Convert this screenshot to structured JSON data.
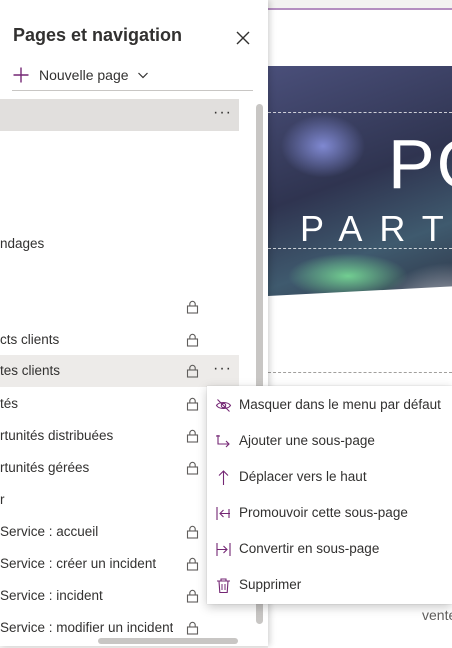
{
  "preview": {
    "hero_title": "PO",
    "hero_subtitle": "PART",
    "footer_text": "vente"
  },
  "panel": {
    "title": "Pages et navigation",
    "new_page_label": "Nouvelle page"
  },
  "nav_items": [
    {
      "label": "",
      "lock": false,
      "selected": true,
      "more": true
    },
    {
      "label": "",
      "lock": false
    },
    {
      "label": "ndages",
      "lock": false
    },
    {
      "label": "",
      "lock": false
    },
    {
      "label": "",
      "lock": true
    },
    {
      "label": "cts clients",
      "lock": true
    },
    {
      "label": "tes clients",
      "lock": true,
      "hover": true,
      "more": true
    },
    {
      "label": "tés",
      "lock": true
    },
    {
      "label": "rtunités distribuées",
      "lock": true
    },
    {
      "label": "rtunités gérées",
      "lock": true
    },
    {
      "label": "r",
      "lock": false
    },
    {
      "label": "Service : accueil",
      "lock": true
    },
    {
      "label": "Service : créer un incident",
      "lock": true
    },
    {
      "label": "Service : incident",
      "lock": true
    },
    {
      "label": "Service : modifier un incident",
      "lock": true
    }
  ],
  "context_menu": {
    "items": [
      {
        "label": "Masquer dans le menu par défaut",
        "icon": "eye-hide-icon"
      },
      {
        "label": "Ajouter une sous-page",
        "icon": "add-subpage-icon"
      },
      {
        "label": "Déplacer vers le haut",
        "icon": "arrow-up-icon"
      },
      {
        "label": "Promouvoir cette sous-page",
        "icon": "promote-icon"
      },
      {
        "label": "Convertir en sous-page",
        "icon": "demote-icon"
      },
      {
        "label": "Supprimer",
        "icon": "trash-icon"
      }
    ]
  },
  "colors": {
    "accent_purple": "#742774",
    "selected_row": "#e1dfdd",
    "hover_row": "#edebe9"
  }
}
